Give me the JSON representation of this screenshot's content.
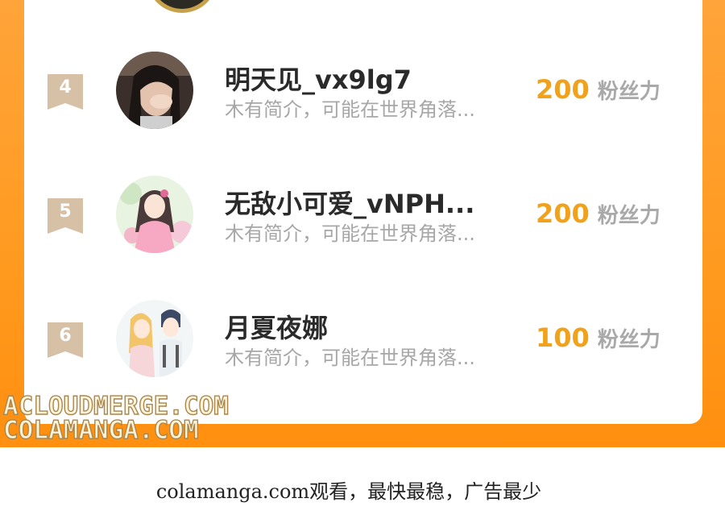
{
  "ranking": {
    "fans_unit": "粉丝力",
    "entries": [
      {
        "rank": "4",
        "name": "明天见_vx9lg7",
        "bio": "木有简介，可能在世界角落...",
        "fans": "200",
        "avatar": "photo-avatar"
      },
      {
        "rank": "5",
        "name": "无敌小可爱_vNPH...",
        "bio": "木有简介，可能在世界角落...",
        "fans": "200",
        "avatar": "anime-girl-avatar"
      },
      {
        "rank": "6",
        "name": "月夏夜娜",
        "bio": "木有简介，可能在世界角落...",
        "fans": "100",
        "avatar": "anime-couple-avatar"
      }
    ]
  },
  "watermark": {
    "line1": "ACLOUDMERGE.COM",
    "line2": "COLAMANGA.COM"
  },
  "footer": {
    "text": "colamanga.com观看，最快最稳，广告最少"
  },
  "colors": {
    "frame": "#ff9a1f",
    "fans_value": "#f0a21c",
    "rank_badge": "#d6c1a6"
  }
}
